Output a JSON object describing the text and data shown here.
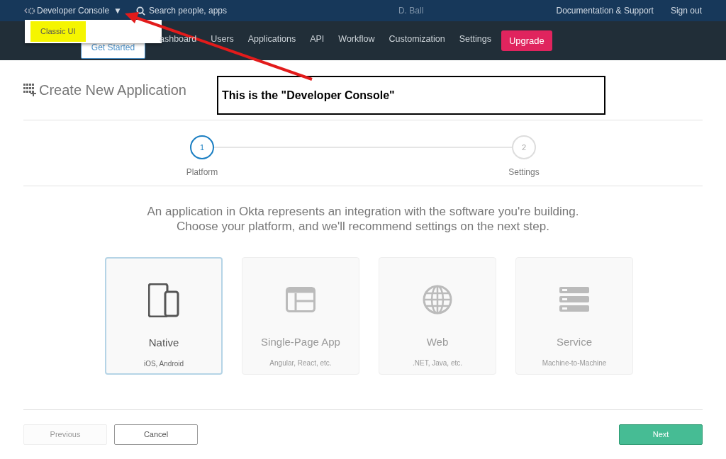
{
  "top_bar": {
    "console_switcher": "Developer Console",
    "caret": "▼",
    "search": {
      "placeholder": "Search people, apps"
    },
    "user": "D. Ball",
    "links": [
      "Documentation & Support",
      "Sign out"
    ]
  },
  "dropdown": {
    "items": [
      {
        "label": "Classic UI",
        "highlighted": true
      }
    ]
  },
  "nav": {
    "get_started": "Get Started",
    "items": [
      "ashboard",
      "Users",
      "Applications",
      "API",
      "Workflow",
      "Customization",
      "Settings"
    ],
    "upgrade": "Upgrade"
  },
  "page": {
    "title": "Create New Application"
  },
  "callout": {
    "text": "This is the \"Developer Console\""
  },
  "steps": [
    {
      "number": "1",
      "label": "Platform",
      "active": true
    },
    {
      "number": "2",
      "label": "Settings",
      "active": false
    }
  ],
  "description": [
    "An application in Okta represents an integration with the software you're building.",
    "Choose your platform, and we'll recommend settings on the next step."
  ],
  "platforms": [
    {
      "kind": "devices",
      "name": "Native",
      "subtitle": "iOS, Android",
      "selected": true
    },
    {
      "kind": "window",
      "name": "Single-Page App",
      "subtitle": "Angular, React, etc.",
      "selected": false
    },
    {
      "kind": "globe",
      "name": "Web",
      "subtitle": ".NET, Java, etc.",
      "selected": false
    },
    {
      "kind": "server",
      "name": "Service",
      "subtitle": "Machine-to-Machine",
      "selected": false
    }
  ],
  "buttons": {
    "previous": {
      "label": "Previous",
      "disabled": true
    },
    "cancel": "Cancel",
    "next": "Next"
  }
}
